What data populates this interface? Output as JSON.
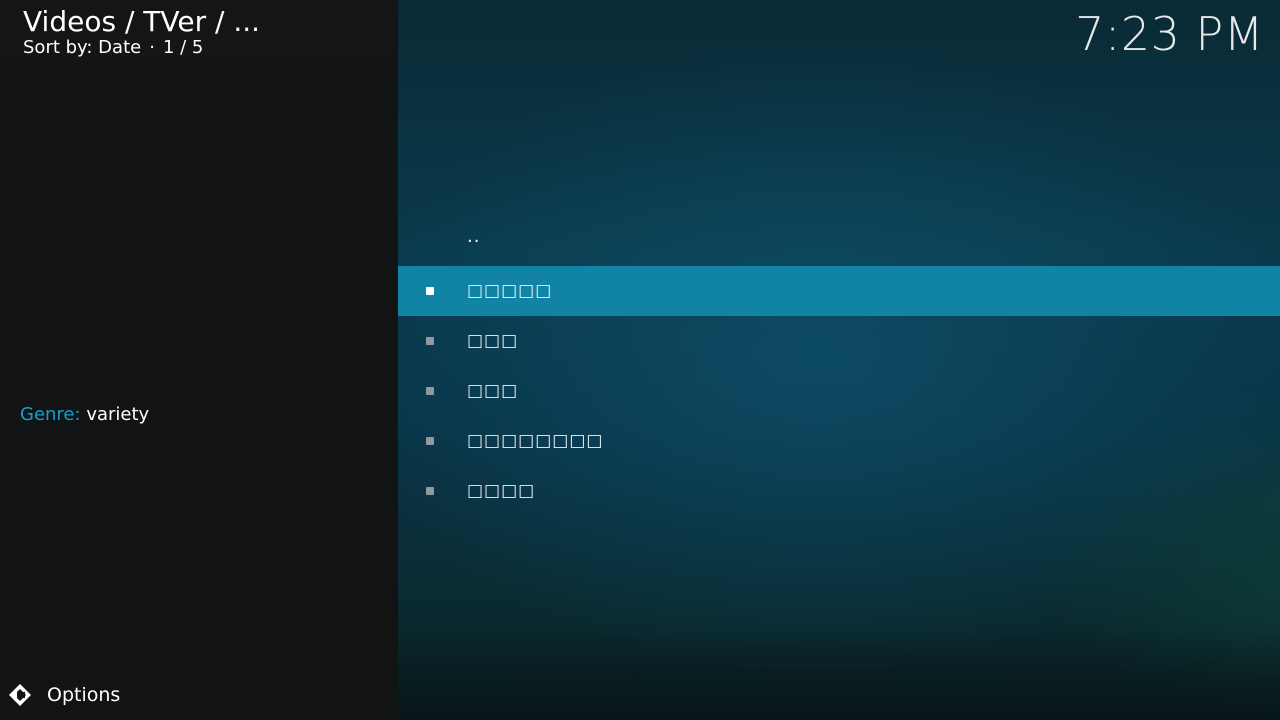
{
  "header": {
    "path": "Videos / TVer / ...",
    "sort_label": "Sort by: Date",
    "separator": "·",
    "position": "1 / 5"
  },
  "clock": {
    "time": "7:23 PM"
  },
  "info": {
    "genre_label": "Genre:",
    "genre_value": "variety"
  },
  "footer": {
    "options_label": "Options",
    "options_icon": "options-icon"
  },
  "list": {
    "selected_index": 1,
    "items": [
      {
        "label": ".."
      },
      {
        "label": "□□□□□"
      },
      {
        "label": "□□□"
      },
      {
        "label": "□□□"
      },
      {
        "label": "□□□□□□□□"
      },
      {
        "label": "□□□□"
      }
    ]
  },
  "colors": {
    "accent": "#12a0c8",
    "selection": "#1184a6"
  }
}
